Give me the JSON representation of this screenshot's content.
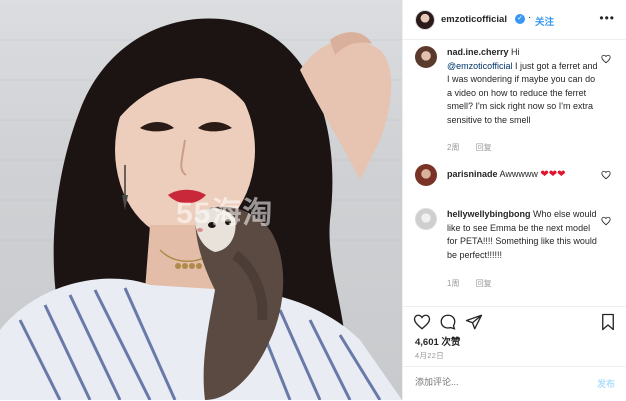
{
  "header": {
    "username": "emzoticofficial",
    "follow_label": "关注",
    "more_label": "•••"
  },
  "watermark": "55海淘",
  "comments": [
    {
      "user": "nad.ine.cherry",
      "mention": "@emzoticofficial",
      "text_before": "Hi",
      "text_after": "I just got a ferret and I was wondering if maybe you can do a video on how to reduce the ferret smell? I'm sick right now so I'm extra sensitive to the smell",
      "time": "2周",
      "reply_label": "回复"
    },
    {
      "user": "parisninade",
      "text": "Awwwww",
      "emoji": "❤❤❤"
    },
    {
      "user": "hellywellybingbong",
      "text": "Who else would like to see Emma be the next model for PETA!!!! Something like this would be perfect!!!!!!",
      "time": "1周",
      "reply_label": "回复"
    }
  ],
  "likes": "4,601 次赞",
  "date": "4月22日",
  "add_comment": {
    "placeholder": "添加评论...",
    "post_label": "发布"
  },
  "colors": {
    "accent": "#3897f0",
    "mention": "#003569",
    "muted": "#999999",
    "post_disabled": "#b2dffc"
  }
}
